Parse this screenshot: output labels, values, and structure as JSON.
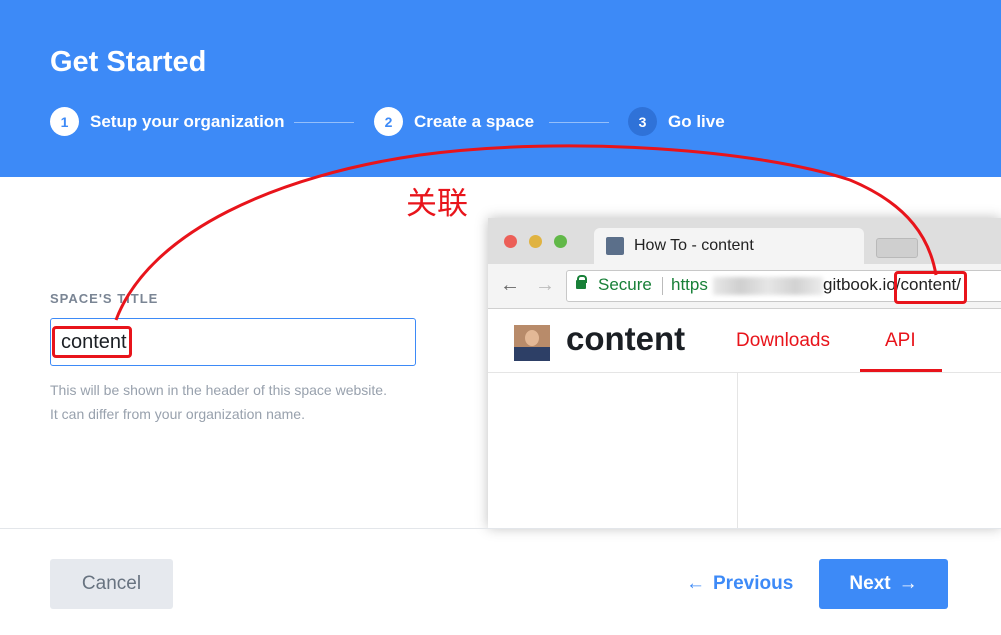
{
  "header": {
    "title": "Get Started",
    "steps": [
      {
        "number": "1",
        "label": "Setup your organization"
      },
      {
        "number": "2",
        "label": "Create a space"
      },
      {
        "number": "3",
        "label": "Go live"
      }
    ]
  },
  "form": {
    "label": "SPACE'S TITLE",
    "value": "content",
    "help_line1": "This will be shown in the header of this space website.",
    "help_line2": "It can differ from your organization name."
  },
  "preview": {
    "tab_title": "How To - content",
    "secure_label": "Secure",
    "url_scheme": "https",
    "url_tail": "gitbook.io/content/",
    "site_name": "content",
    "nav": [
      "Downloads",
      "API"
    ]
  },
  "annotation": {
    "text": "关联",
    "color": "#e8141b"
  },
  "footer": {
    "cancel": "Cancel",
    "previous": "Previous",
    "next": "Next"
  },
  "colors": {
    "primary": "#3d8af7",
    "annotation_red": "#e8141b"
  }
}
